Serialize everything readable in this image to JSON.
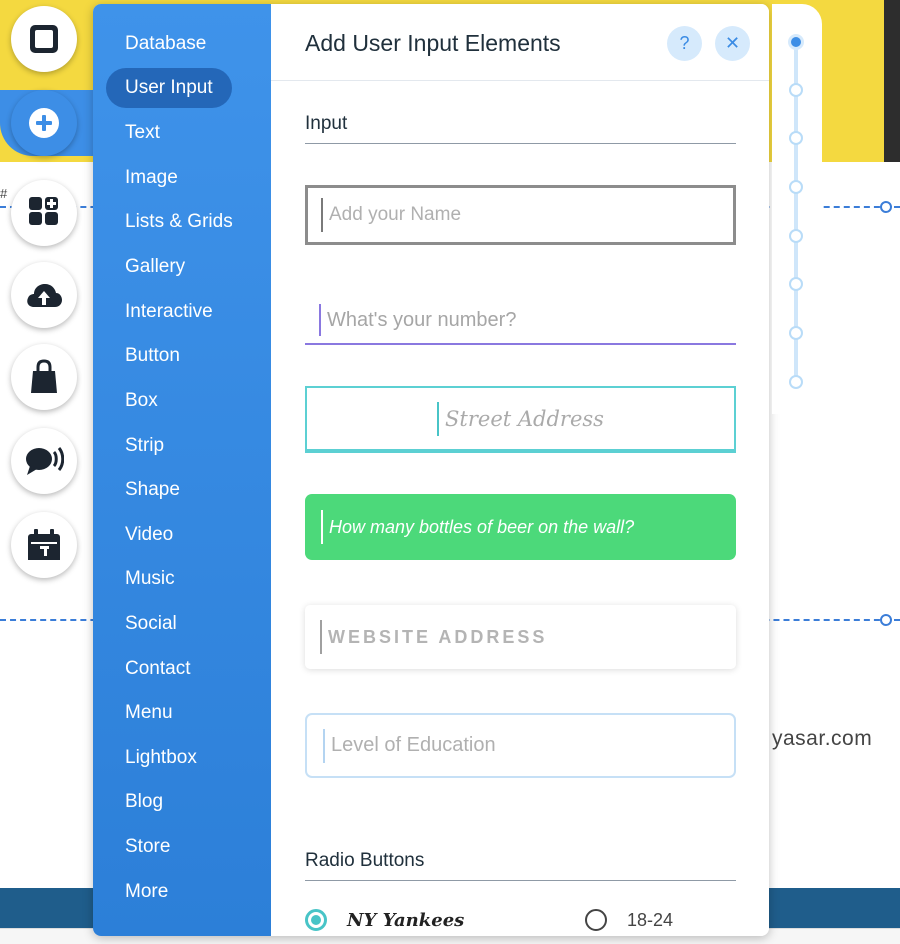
{
  "background": {
    "hash_text": "#",
    "domain_text": "yasar.com"
  },
  "rail": {
    "buttons": [
      {
        "name": "background-button",
        "icon": "square-icon",
        "active": false
      },
      {
        "name": "add-button",
        "icon": "plus-icon",
        "active": true
      },
      {
        "name": "add-apps-button",
        "icon": "apps-plus-icon",
        "active": false
      },
      {
        "name": "upload-button",
        "icon": "cloud-upload-icon",
        "active": false
      },
      {
        "name": "store-button",
        "icon": "shopping-bag-icon",
        "active": false
      },
      {
        "name": "chat-button",
        "icon": "chat-icon",
        "active": false
      },
      {
        "name": "bookings-button",
        "icon": "calendar-icon",
        "active": false
      }
    ]
  },
  "categories": {
    "selected": "User Input",
    "items": [
      "Database",
      "User Input",
      "Text",
      "Image",
      "Lists & Grids",
      "Gallery",
      "Interactive",
      "Button",
      "Box",
      "Strip",
      "Shape",
      "Video",
      "Music",
      "Social",
      "Contact",
      "Menu",
      "Lightbox",
      "Blog",
      "Store",
      "More"
    ]
  },
  "panel": {
    "title": "Add User Input Elements",
    "help_label": "?",
    "close_label": "✕"
  },
  "input_section": {
    "title": "Input",
    "fields": [
      "Add your Name",
      "What's your number?",
      "Street Address",
      "How many bottles of beer on the wall?",
      "WEBSITE ADDRESS",
      "Level of Education"
    ]
  },
  "radio_section": {
    "title": "Radio Buttons",
    "options": [
      {
        "label": "NY Yankees",
        "checked": true
      },
      {
        "label": "18-24",
        "checked": false
      }
    ]
  },
  "colors": {
    "accent": "#3d8ee6",
    "category_bg": "#2c7fd8",
    "selected_category": "#2467b8",
    "header_yellow": "#f4d940",
    "green_field": "#4cd97a",
    "teal": "#48c4c7",
    "purple": "#8a78e0"
  },
  "scroller": {
    "dot_count": 8,
    "active_index": 0
  }
}
